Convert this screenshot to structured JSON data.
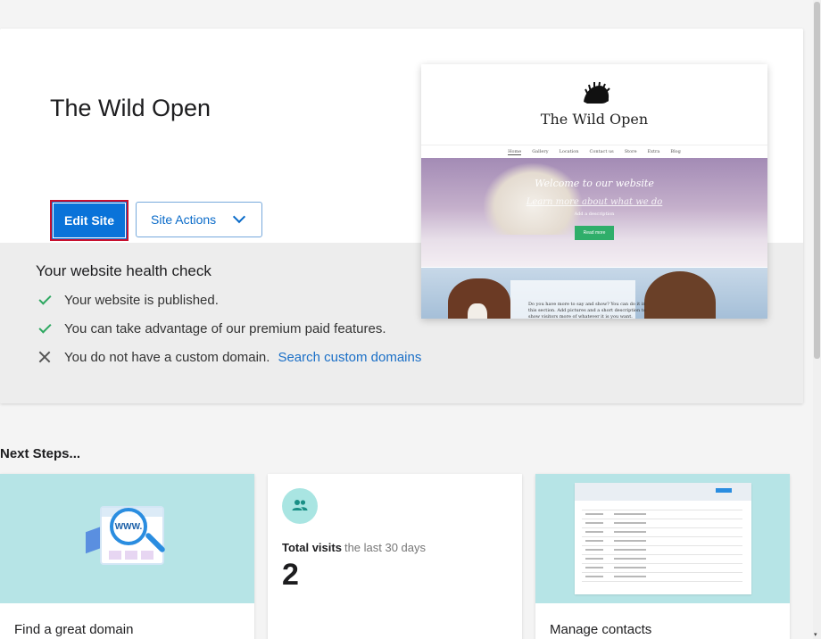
{
  "site": {
    "title": "The Wild Open",
    "edit_label": "Edit Site",
    "actions_label": "Site Actions"
  },
  "health": {
    "heading": "Your website health check",
    "items": [
      {
        "status": "ok",
        "icon": "check-icon",
        "text": "Your website is published."
      },
      {
        "status": "ok",
        "icon": "check-icon",
        "text": "You can take advantage of our premium paid features."
      },
      {
        "status": "missing",
        "icon": "cross-icon",
        "text": "You do not have a custom domain.",
        "link": "Search custom domains"
      }
    ]
  },
  "preview": {
    "site_name": "The Wild Open",
    "nav": [
      "Home",
      "Gallery",
      "Location",
      "Contact us",
      "Store",
      "Extra",
      "Blog"
    ],
    "hero_title": "Welcome to our website",
    "hero_link": "Learn more about what we do",
    "hero_sub": "Add a description",
    "hero_button": "Read more",
    "section_text": "Do you have more to say and show? You can do it in this section. Add pictures and a short description to show visitors more of whatever it is you want."
  },
  "next_steps": {
    "heading": "Next Steps...",
    "domain_tile": {
      "label": "Find a great domain",
      "badge": "WWW."
    },
    "visits_tile": {
      "label": "Total visits",
      "period": "the last 30 days",
      "count": "2"
    },
    "contacts_tile": {
      "label": "Manage contacts"
    }
  },
  "colors": {
    "primary": "#0a73d9",
    "focus_border": "#c8102e",
    "success": "#2ea861",
    "link": "#1a6fc7",
    "tile_banner": "#b6e4e6"
  }
}
